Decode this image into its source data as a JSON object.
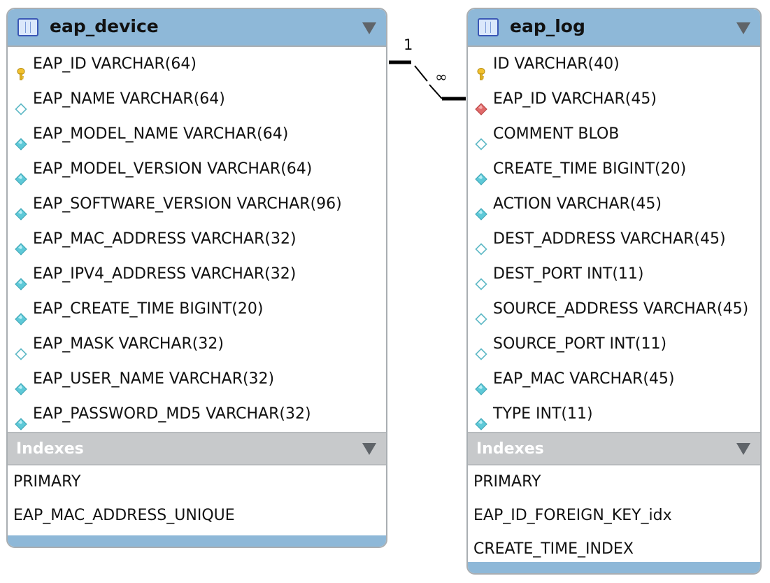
{
  "relationship": {
    "left_cardinality": "1",
    "right_cardinality": "∞"
  },
  "tables": [
    {
      "name": "eap_device",
      "icon": "table-icon",
      "columns": [
        {
          "text": "EAP_ID VARCHAR(64)",
          "icon": "primary-key-icon"
        },
        {
          "text": "EAP_NAME VARCHAR(64)",
          "icon": "nullable-column-icon"
        },
        {
          "text": "EAP_MODEL_NAME VARCHAR(64)",
          "icon": "not-null-column-icon"
        },
        {
          "text": "EAP_MODEL_VERSION VARCHAR(64)",
          "icon": "not-null-column-icon"
        },
        {
          "text": "EAP_SOFTWARE_VERSION VARCHAR(96)",
          "icon": "not-null-column-icon"
        },
        {
          "text": "EAP_MAC_ADDRESS VARCHAR(32)",
          "icon": "not-null-column-icon"
        },
        {
          "text": "EAP_IPV4_ADDRESS VARCHAR(32)",
          "icon": "not-null-column-icon"
        },
        {
          "text": "EAP_CREATE_TIME BIGINT(20)",
          "icon": "not-null-column-icon"
        },
        {
          "text": "EAP_MASK VARCHAR(32)",
          "icon": "nullable-column-icon"
        },
        {
          "text": "EAP_USER_NAME VARCHAR(32)",
          "icon": "not-null-column-icon"
        },
        {
          "text": "EAP_PASSWORD_MD5 VARCHAR(32)",
          "icon": "not-null-column-icon"
        }
      ],
      "indexes_title": "Indexes",
      "indexes": [
        "PRIMARY",
        "EAP_MAC_ADDRESS_UNIQUE"
      ]
    },
    {
      "name": "eap_log",
      "icon": "table-icon",
      "columns": [
        {
          "text": "ID VARCHAR(40)",
          "icon": "primary-key-icon"
        },
        {
          "text": "EAP_ID VARCHAR(45)",
          "icon": "foreign-key-icon"
        },
        {
          "text": "COMMENT BLOB",
          "icon": "nullable-column-icon"
        },
        {
          "text": "CREATE_TIME BIGINT(20)",
          "icon": "not-null-column-icon"
        },
        {
          "text": "ACTION VARCHAR(45)",
          "icon": "not-null-column-icon"
        },
        {
          "text": "DEST_ADDRESS VARCHAR(45)",
          "icon": "nullable-column-icon"
        },
        {
          "text": "DEST_PORT INT(11)",
          "icon": "nullable-column-icon"
        },
        {
          "text": "SOURCE_ADDRESS VARCHAR(45)",
          "icon": "nullable-column-icon"
        },
        {
          "text": "SOURCE_PORT INT(11)",
          "icon": "nullable-column-icon"
        },
        {
          "text": "EAP_MAC VARCHAR(45)",
          "icon": "not-null-column-icon"
        },
        {
          "text": "TYPE INT(11)",
          "icon": "not-null-column-icon"
        }
      ],
      "indexes_title": "Indexes",
      "indexes": [
        "PRIMARY",
        "EAP_ID_FOREIGN_KEY_idx",
        "CREATE_TIME_INDEX"
      ]
    }
  ]
}
